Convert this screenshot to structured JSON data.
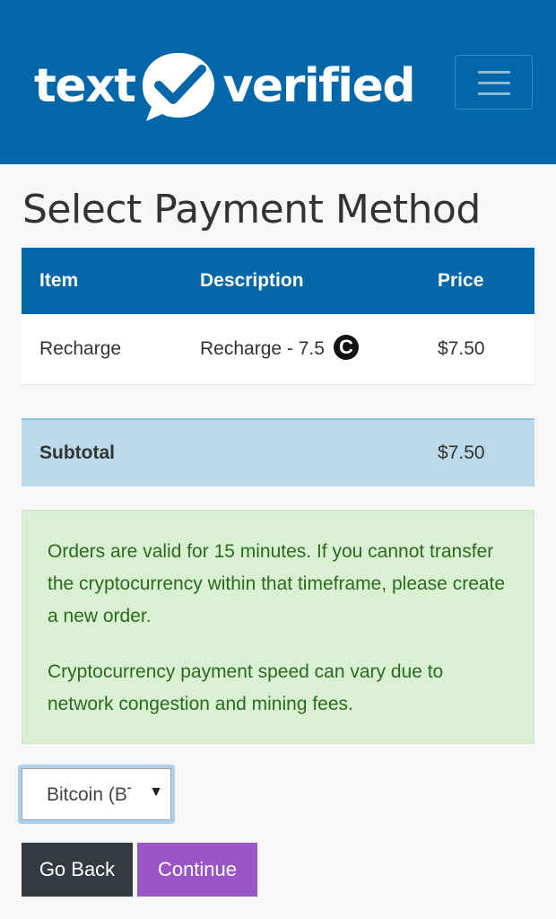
{
  "brand": {
    "logo_left": "text",
    "logo_right": "verified",
    "logo_icon": "checkmark-speech-bubble-icon"
  },
  "nav": {
    "menu_icon": "hamburger-menu-icon"
  },
  "page": {
    "title": "Select Payment Method"
  },
  "table": {
    "headers": [
      "Item",
      "Description",
      "Price"
    ],
    "rows": [
      {
        "item": "Recharge",
        "description": "Recharge - 7.5",
        "currency_icon": "credit-coin-icon",
        "price": "$7.50"
      }
    ]
  },
  "subtotal": {
    "label": "Subtotal",
    "value": "$7.50"
  },
  "notice": {
    "line1": "Orders are valid for 15 minutes. If you cannot transfer the cryptocurrency within that timeframe, please create a new order.",
    "line2": "Cryptocurrency payment speed can vary due to network congestion and mining fees."
  },
  "payment_select": {
    "selected": "Bitcoin (BTC)"
  },
  "buttons": {
    "back": "Go Back",
    "continue": "Continue"
  },
  "colors": {
    "brand_blue": "#0267a8",
    "subtotal_bg": "#bad9ea",
    "notice_bg": "#d9f1d2",
    "notice_text": "#2a6a1f",
    "back_button": "#343a40",
    "continue_button": "#9a55c7"
  }
}
